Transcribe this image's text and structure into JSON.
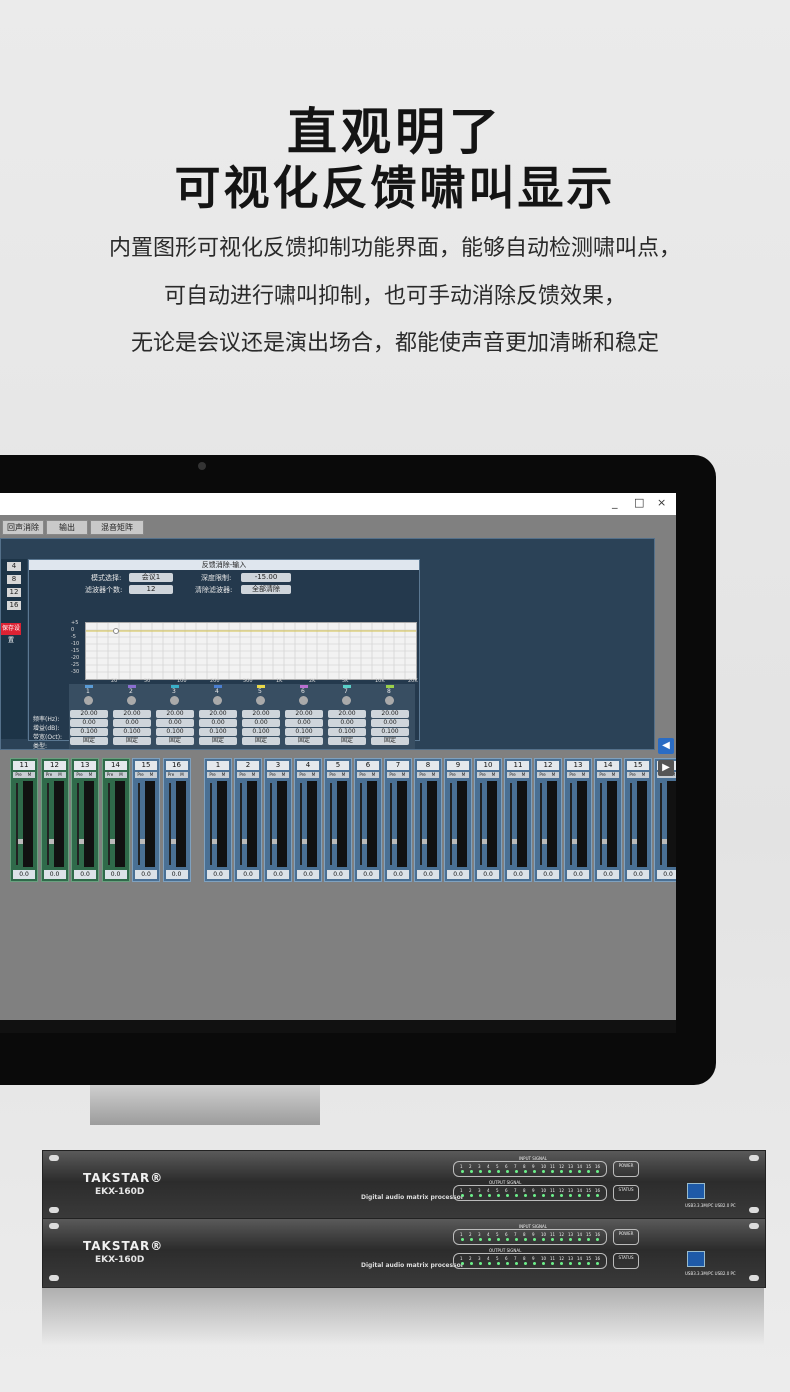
{
  "heading": {
    "line1": "直观明了",
    "line2": "可视化反馈啸叫显示"
  },
  "description": [
    "内置图形可视化反馈抑制功能界面，能够自动检测啸叫点，",
    "可自动进行啸叫抑制，也可手动消除反馈效果，",
    "无论是会议还是演出场合，都能使声音更加清晰和稳定"
  ],
  "window": {
    "buttons": [
      "_",
      "□",
      "×"
    ]
  },
  "tabs": [
    "回声消除",
    "输出",
    "混音矩阵"
  ],
  "left_numbers": [
    "4",
    "8",
    "12",
    "16"
  ],
  "left_button": "保存设置",
  "feedback": {
    "title": "反馈消除-输入",
    "mode_label": "模式选择:",
    "mode_value": "会议1",
    "depth_label": "深度限制:",
    "depth_value": "-15.00",
    "filters_label": "滤波器个数:",
    "filters_value": "12",
    "clear_label": "清除滤波器:",
    "clear_button": "全部清除",
    "y_ticks": [
      "+5",
      "0",
      "-5",
      "-10",
      "-15",
      "-20",
      "-25",
      "-30"
    ],
    "x_ticks": [
      "20",
      "50",
      "100",
      "200",
      "500",
      "1K",
      "2K",
      "5K",
      "10K",
      "20K"
    ],
    "row_labels": [
      "频率(Hz):",
      "增益(dB):",
      "带宽(Oct):",
      "类型:"
    ],
    "bands": [
      {
        "n": "1",
        "freq": "20.00",
        "gain": "0.00",
        "bw": "0.100",
        "type": "固定"
      },
      {
        "n": "2",
        "freq": "20.00",
        "gain": "0.00",
        "bw": "0.100",
        "type": "固定"
      },
      {
        "n": "3",
        "freq": "20.00",
        "gain": "0.00",
        "bw": "0.100",
        "type": "固定"
      },
      {
        "n": "4",
        "freq": "20.00",
        "gain": "0.00",
        "bw": "0.100",
        "type": "固定"
      },
      {
        "n": "5",
        "freq": "20.00",
        "gain": "0.00",
        "bw": "0.100",
        "type": "固定"
      },
      {
        "n": "6",
        "freq": "20.00",
        "gain": "0.00",
        "bw": "0.100",
        "type": "固定"
      },
      {
        "n": "7",
        "freq": "20.00",
        "gain": "0.00",
        "bw": "0.100",
        "type": "固定"
      },
      {
        "n": "8",
        "freq": "20.00",
        "gain": "0.00",
        "bw": "0.100",
        "type": "固定"
      }
    ]
  },
  "input_strips": [
    "11",
    "12",
    "13",
    "14",
    "15",
    "16"
  ],
  "output_strips": [
    "1",
    "2",
    "3",
    "4",
    "5",
    "6",
    "7",
    "8",
    "9",
    "10",
    "11",
    "12",
    "13",
    "14",
    "15",
    "16"
  ],
  "strip_buttons": [
    "Pre",
    "M"
  ],
  "strip_value": "0.0",
  "nav_arrows": [
    "◀",
    "▶"
  ],
  "device": {
    "brand": "TAKSTAR®",
    "model": "EKX-160D",
    "product": "Digital audio matrix processor",
    "input_label": "INPUT SIGNAL",
    "output_label": "OUTPUT SIGNAL",
    "power": "POWER",
    "status": "STATUS",
    "usb": "USB3.3.3M/PC USB2.0 PC",
    "led_numbers": [
      "1",
      "2",
      "3",
      "4",
      "5",
      "6",
      "7",
      "8",
      "9",
      "10",
      "11",
      "12",
      "13",
      "14",
      "15",
      "16"
    ]
  },
  "colors": {
    "panel": "#2b4257",
    "strip_out": "#4a7094",
    "strip_in": "#2f6a4a",
    "accent": "#1e5aa8"
  }
}
